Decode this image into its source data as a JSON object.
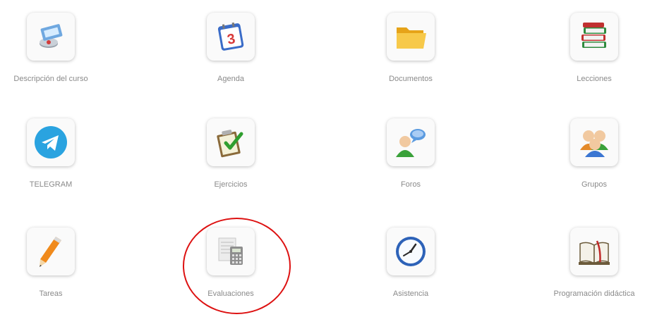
{
  "tools": [
    {
      "label": "Descripción del curso",
      "icon": "course-description-icon"
    },
    {
      "label": "Agenda",
      "icon": "calendar-icon",
      "day": "3"
    },
    {
      "label": "Documentos",
      "icon": "folder-icon"
    },
    {
      "label": "Lecciones",
      "icon": "books-icon"
    },
    {
      "label": "TELEGRAM",
      "icon": "telegram-icon"
    },
    {
      "label": "Ejercicios",
      "icon": "exercises-icon"
    },
    {
      "label": "Foros",
      "icon": "forum-icon"
    },
    {
      "label": "Grupos",
      "icon": "groups-icon"
    },
    {
      "label": "Tareas",
      "icon": "pencil-icon"
    },
    {
      "label": "Evaluaciones",
      "icon": "calculator-icon"
    },
    {
      "label": "Asistencia",
      "icon": "clock-icon"
    },
    {
      "label": "Programación didáctica",
      "icon": "open-book-icon"
    }
  ],
  "highlight": {
    "target": "Evaluaciones",
    "color": "#dd1111"
  }
}
